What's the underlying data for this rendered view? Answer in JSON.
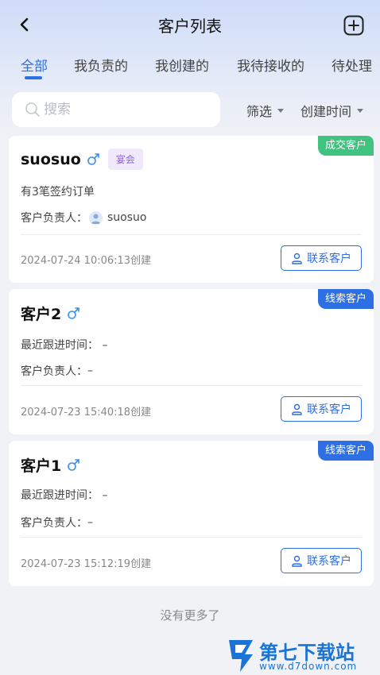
{
  "header": {
    "title": "客户列表"
  },
  "tabs": [
    {
      "label": "全部",
      "active": true
    },
    {
      "label": "我负责的",
      "active": false
    },
    {
      "label": "我创建的",
      "active": false
    },
    {
      "label": "我待接收的",
      "active": false
    },
    {
      "label": "待处理",
      "active": false
    }
  ],
  "search": {
    "placeholder": "搜索",
    "value": ""
  },
  "filters": {
    "filter_label": "筛选",
    "sort_label": "创建时间"
  },
  "customers": [
    {
      "name": "suosuo",
      "gender_icon": "male-icon",
      "badge": "宴会",
      "tag": "成交客户",
      "tag_color": "#3fc37e",
      "info_line": "有3笔签约订单",
      "owner_label": "客户负责人：",
      "owner_value": "suosuo",
      "created": "2024-07-24 10:06:13创建",
      "contact_label": "联系客户"
    },
    {
      "name": "客户2",
      "gender_icon": "male-icon",
      "tag": "线索客户",
      "tag_color": "#2f6fe4",
      "info_line": "最近跟进时间：  –",
      "owner_label": "客户负责人：",
      "owner_value": "–",
      "created": "2024-07-23 15:40:18创建",
      "contact_label": "联系客户"
    },
    {
      "name": "客户1",
      "gender_icon": "male-icon",
      "tag": "线索客户",
      "tag_color": "#2f6fe4",
      "info_line": "最近跟进时间：  –",
      "owner_label": "客户负责人：",
      "owner_value": "–",
      "created": "2024-07-23 15:12:19创建",
      "contact_label": "联系客户"
    }
  ],
  "footer": {
    "no_more": "没有更多了"
  },
  "watermark": {
    "text": "第七下载站",
    "url": "www.d7down.com"
  },
  "colors": {
    "accent": "#2f6fe4",
    "deal": "#3fc37e",
    "badge_text": "#8c62d4"
  }
}
